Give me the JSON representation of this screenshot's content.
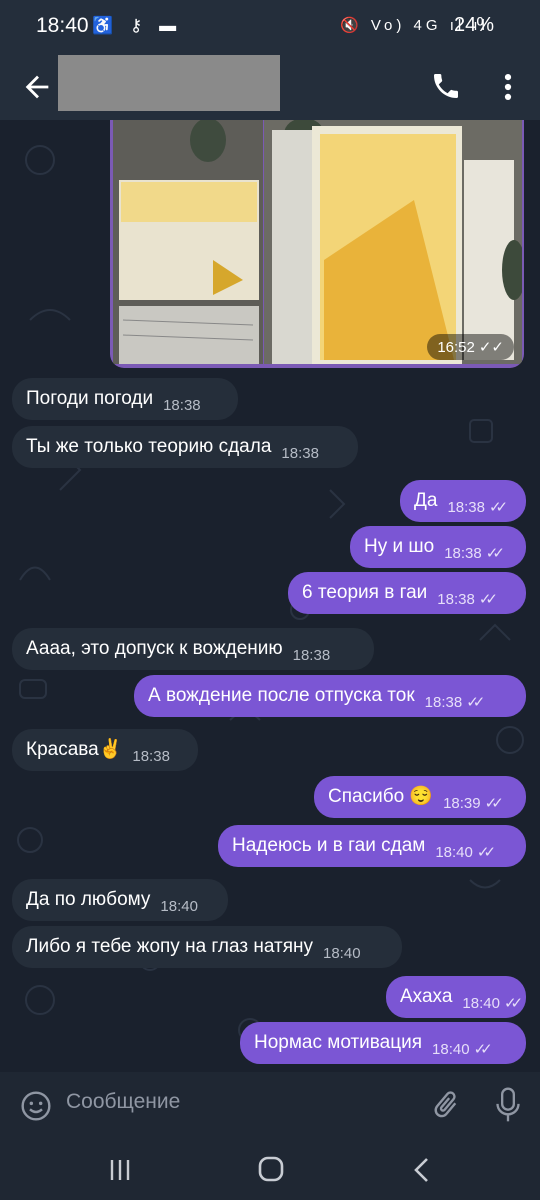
{
  "status_bar": {
    "time": "18:40",
    "left_icons": "♿ ⚷ ▬",
    "right_icons": "🔇 Vo) 4G ıl ıl",
    "battery": "24%"
  },
  "header": {
    "back_icon": "arrow-left",
    "call_icon": "phone",
    "more_icon": "dots-vertical"
  },
  "media_message": {
    "time": "16:52",
    "ticks": "✓✓"
  },
  "messages": [
    {
      "dir": "in",
      "text": "Погоди погоди",
      "time": "18:38"
    },
    {
      "dir": "in",
      "text": "Ты же только теорию сдала",
      "time": "18:38"
    },
    {
      "dir": "out",
      "text": "Да",
      "time": "18:38",
      "ticks": "✓✓"
    },
    {
      "dir": "out",
      "text": "Ну и шо",
      "time": "18:38",
      "ticks": "✓✓"
    },
    {
      "dir": "out",
      "text": "6 теория в гаи",
      "time": "18:38",
      "ticks": "✓✓"
    },
    {
      "dir": "in",
      "text": "Аааа, это допуск к вождению",
      "time": "18:38"
    },
    {
      "dir": "out",
      "text": "А вождение после отпуска ток",
      "time": "18:38",
      "ticks": "✓✓"
    },
    {
      "dir": "in",
      "text": "Красава✌️",
      "time": "18:38"
    },
    {
      "dir": "out",
      "text": "Спасибо 😌",
      "time": "18:39",
      "ticks": "✓✓"
    },
    {
      "dir": "out",
      "text": "Надеюсь и в гаи сдам",
      "time": "18:40",
      "ticks": "✓✓"
    },
    {
      "dir": "in",
      "text": "Да по любому",
      "time": "18:40"
    },
    {
      "dir": "in",
      "text": "Либо я тебе жопу на глаз натяну",
      "time": "18:40"
    },
    {
      "dir": "out",
      "text": "Ахаха",
      "time": "18:40",
      "ticks": "✓✓"
    },
    {
      "dir": "out",
      "text": "Нормас мотивация",
      "time": "18:40",
      "ticks": "✓✓"
    }
  ],
  "input": {
    "placeholder": "Сообщение",
    "emoji_icon": "smiley",
    "attach_icon": "paperclip",
    "mic_icon": "microphone"
  },
  "nav_bar": {
    "recents_icon": "recents",
    "home_icon": "home",
    "back_icon": "back"
  },
  "colors": {
    "outgoing_bubble": "#7b56d4",
    "incoming_bubble": "#252e3a",
    "chat_background": "#1a212d",
    "header": "#242e3b"
  }
}
